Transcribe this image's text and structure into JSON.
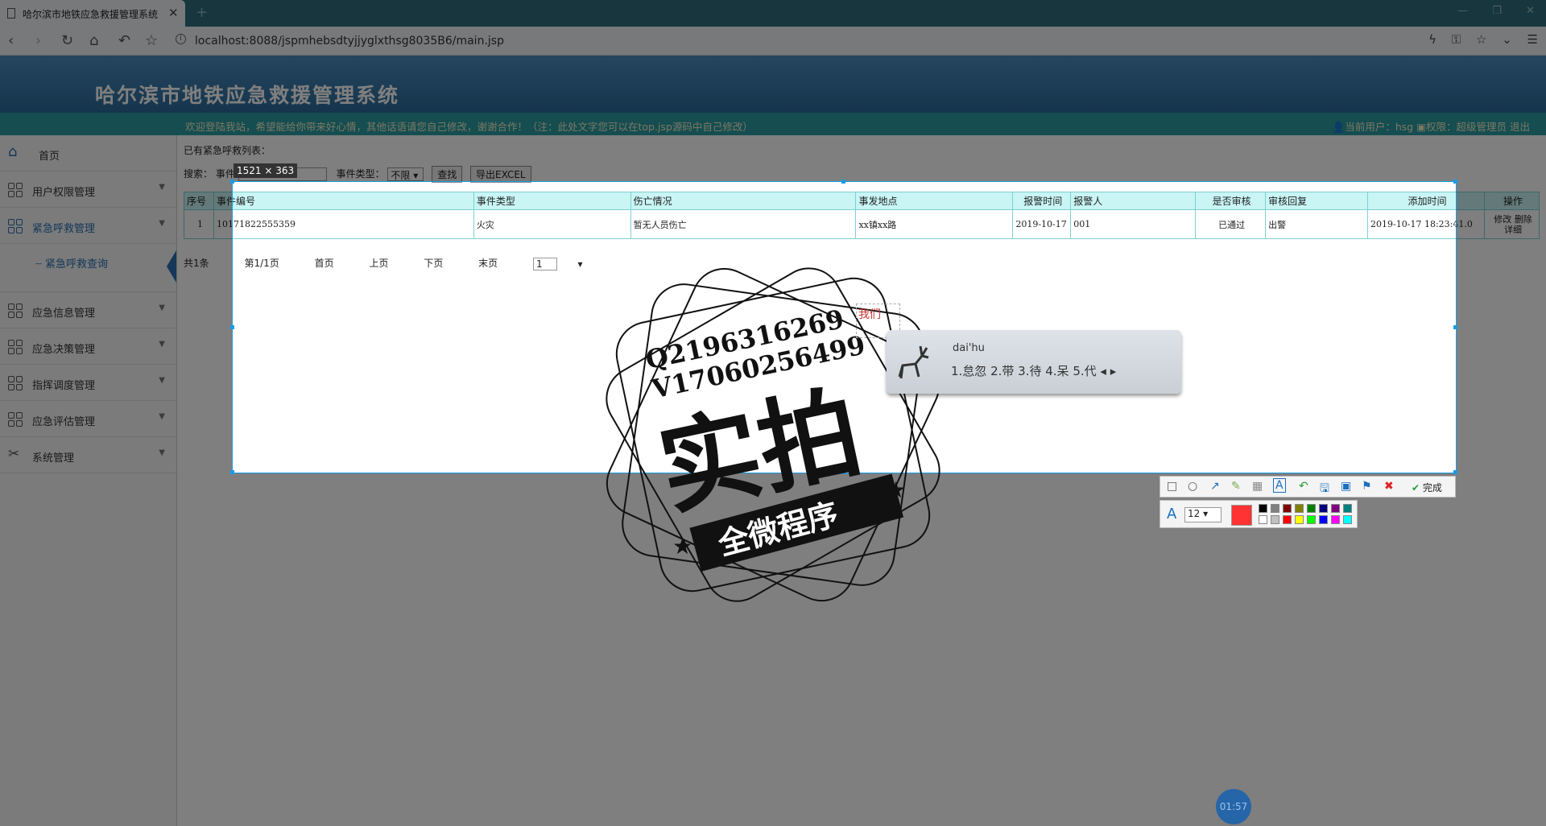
{
  "browser": {
    "tab_title": "哈尔滨市地铁应急救援管理系统",
    "url": "localhost:8088/jspmhebsdtyjjyglxthsg8035B6/main.jsp"
  },
  "header": {
    "system_title": "哈尔滨市地铁应急救援管理系统",
    "welcome_text": "欢迎登陆我站，希望能给你带来好心情，其他话语请您自己修改，谢谢合作！（注：此处文字您可以在top.jsp源码中自己修改）",
    "current_user_label": "当前用户：hsg",
    "permission_label": "权限：超级管理员",
    "logout_label": "退出"
  },
  "sidebar": {
    "items": [
      {
        "label": "首页",
        "icon": "home-icon"
      },
      {
        "label": "用户权限管理",
        "icon": "grid-icon"
      },
      {
        "label": "紧急呼救管理",
        "icon": "grid-icon"
      },
      {
        "label": "紧急呼救查询",
        "icon": "none"
      },
      {
        "label": "应急信息管理",
        "icon": "grid-icon"
      },
      {
        "label": "应急决策管理",
        "icon": "grid-icon"
      },
      {
        "label": "指挥调度管理",
        "icon": "grid-icon"
      },
      {
        "label": "应急评估管理",
        "icon": "grid-icon"
      },
      {
        "label": "系统管理",
        "icon": "tools-icon"
      }
    ]
  },
  "content": {
    "list_label": "已有紧急呼救列表：",
    "search_label": "搜索：",
    "event_id_label": "事件",
    "event_type_label": "事件类型：",
    "event_type_value": "不限",
    "search_button": "查找",
    "export_button": "导出EXCEL",
    "table": {
      "headers": [
        "序号",
        "事件编号",
        "事件类型",
        "伤亡情况",
        "事发地点",
        "报警时间",
        "报警人",
        "是否审核",
        "审核回复",
        "添加时间",
        "操作"
      ],
      "rows": [
        {
          "no": "1",
          "event_id": "10171822555359",
          "type": "火灾",
          "casualty": "暂无人员伤亡",
          "location": "xx镇xx路",
          "alarm_time": "2019-10-17",
          "reporter": "001",
          "audited": "已通过",
          "reply": "出警",
          "added": "2019-10-17 18:23:41.0",
          "op1": "修改",
          "op2": "删除",
          "op3": "详细"
        }
      ]
    },
    "pager": {
      "total": "共1条",
      "page_info": "第1/1页",
      "first": "首页",
      "prev": "上页",
      "next": "下页",
      "last": "末页",
      "page_select": "1"
    }
  },
  "screenshot_tool": {
    "size_badge": "1521 × 363",
    "typed_text": "我们",
    "done_label": "完成",
    "font_size": "12",
    "current_color": "#ff3333",
    "palette": [
      "#000000",
      "#808080",
      "#800000",
      "#808000",
      "#008000",
      "#000080",
      "#800080",
      "#008080",
      "#ffffff",
      "#c0c0c0",
      "#ff0000",
      "#ffff00",
      "#00ff00",
      "#0000ff",
      "#ff00ff",
      "#00ffff"
    ]
  },
  "ime": {
    "pinyin": "dai'hu",
    "candidates": "1.怠忽  2.带  3.待  4.呆  5.代"
  },
  "watermark": {
    "line1": "Q2196316269",
    "line2": "V17060256499",
    "big": "实拍",
    "banner": "全微程序"
  },
  "timer": "01:57"
}
